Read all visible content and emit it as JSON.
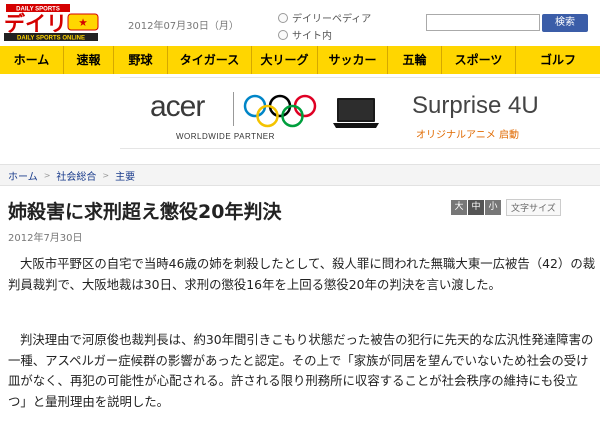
{
  "header": {
    "logo_top": "DAILY SPORTS",
    "logo_main": "デイリー",
    "logo_sub": "DAILY SPORTS ONLINE",
    "date": "2012年07月30日（月）",
    "search": {
      "options": [
        "デイリーペディア",
        "サイト内"
      ],
      "button": "検索",
      "value": ""
    }
  },
  "nav": {
    "items": [
      "ホーム",
      "速報",
      "野球",
      "タイガース",
      "大リーグ",
      "サッカー",
      "五輪",
      "スポーツ",
      "ゴルフ"
    ]
  },
  "ad": {
    "brand": "acer",
    "partner": "WORLDWIDE PARTNER",
    "title": "Surprise 4U",
    "subtitle": "オリジナルアニメ 启動"
  },
  "breadcrumb": {
    "items": [
      "ホーム",
      "社会総合",
      "主要"
    ]
  },
  "article": {
    "title": "姉殺害に求刑超え懲役20年判決",
    "date": "2012年7月30日",
    "text_size": {
      "large": "大",
      "medium": "中",
      "small": "小",
      "label": "文字サイズ"
    },
    "paragraphs": [
      "大阪市平野区の自宅で当時46歳の姉を刺殺したとして、殺人罪に問われた無職大東一広被告（42）の裁判員裁判で、大阪地裁は30日、求刑の懲役16年を上回る懲役20年の判決を言い渡した。",
      "判決理由で河原俊也裁判長は、約30年間引きこもり状態だった被告の犯行に先天的な広汎性発達障害の一種、アスペルガー症候群の影響があったと認定。その上で「家族が同居を望んでいないため社会の受け皿がなく、再犯の可能性が心配される。許される限り刑務所に収容することが社会秩序の維持にも役立つ」と量刑理由を説明した。"
    ]
  },
  "colors": {
    "nav_bg": "#ffd600",
    "logo_red": "#d40000",
    "search_button": "#3b5da8",
    "link_blue": "#1a3c8c",
    "ad_orange": "#e06a00"
  }
}
